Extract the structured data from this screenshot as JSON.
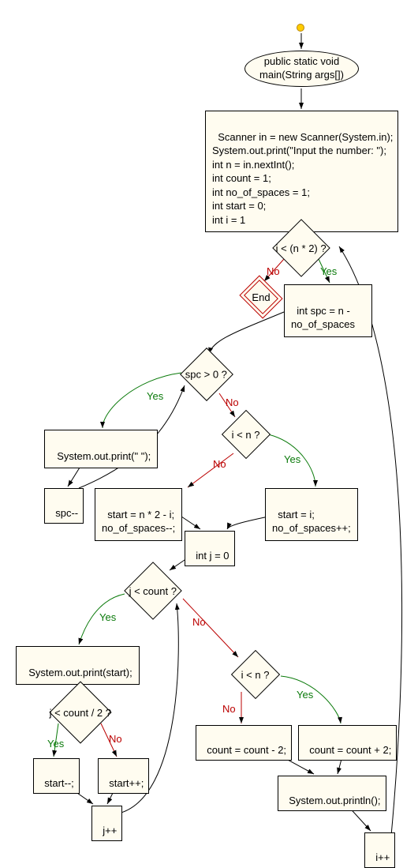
{
  "chart_data": {
    "type": "flowchart",
    "title": "",
    "nodes": [
      {
        "id": "start",
        "type": "start",
        "label": ""
      },
      {
        "id": "main",
        "type": "terminal",
        "label": "public static void\nmain(String args[])"
      },
      {
        "id": "init",
        "type": "process",
        "label": "Scanner in = new Scanner(System.in);\nSystem.out.print(\"Input the number: \");\nint n = in.nextInt();\nint count = 1;\nint no_of_spaces = 1;\nint start = 0;\nint i = 1"
      },
      {
        "id": "d1",
        "type": "decision",
        "label": "i < (n * 2) ?"
      },
      {
        "id": "end",
        "type": "end",
        "label": "End"
      },
      {
        "id": "spc",
        "type": "process",
        "label": "int spc = n -\nno_of_spaces"
      },
      {
        "id": "d2",
        "type": "decision",
        "label": "spc > 0 ?"
      },
      {
        "id": "pspace",
        "type": "process",
        "label": "System.out.print(\" \");"
      },
      {
        "id": "spcdec",
        "type": "process",
        "label": "spc--"
      },
      {
        "id": "d3",
        "type": "decision",
        "label": "i < n ?"
      },
      {
        "id": "startn2i",
        "type": "process",
        "label": "start = n * 2 - i;\nno_of_spaces--;"
      },
      {
        "id": "starti",
        "type": "process",
        "label": "start = i;\nno_of_spaces++;"
      },
      {
        "id": "j0",
        "type": "process",
        "label": "int j = 0"
      },
      {
        "id": "d4",
        "type": "decision",
        "label": "j < count ?"
      },
      {
        "id": "pstart",
        "type": "process",
        "label": "System.out.print(start);"
      },
      {
        "id": "d5",
        "type": "decision",
        "label": "j < count / 2 ?"
      },
      {
        "id": "startdec",
        "type": "process",
        "label": "start--;"
      },
      {
        "id": "startinc",
        "type": "process",
        "label": "start++;"
      },
      {
        "id": "jinc",
        "type": "process",
        "label": "j++"
      },
      {
        "id": "d6",
        "type": "decision",
        "label": "i < n ?"
      },
      {
        "id": "countdec",
        "type": "process",
        "label": "count = count - 2;"
      },
      {
        "id": "countinc",
        "type": "process",
        "label": "count = count + 2;"
      },
      {
        "id": "println",
        "type": "process",
        "label": "System.out.println();"
      },
      {
        "id": "iinc",
        "type": "process",
        "label": "i++"
      }
    ],
    "edges": [
      {
        "from": "start",
        "to": "main",
        "label": ""
      },
      {
        "from": "main",
        "to": "init",
        "label": ""
      },
      {
        "from": "init",
        "to": "d1",
        "label": ""
      },
      {
        "from": "d1",
        "to": "end",
        "label": "No"
      },
      {
        "from": "d1",
        "to": "spc",
        "label": "Yes"
      },
      {
        "from": "spc",
        "to": "d2",
        "label": ""
      },
      {
        "from": "d2",
        "to": "pspace",
        "label": "Yes"
      },
      {
        "from": "pspace",
        "to": "spcdec",
        "label": ""
      },
      {
        "from": "spcdec",
        "to": "d2",
        "label": ""
      },
      {
        "from": "d2",
        "to": "d3",
        "label": "No"
      },
      {
        "from": "d3",
        "to": "starti",
        "label": "Yes"
      },
      {
        "from": "d3",
        "to": "startn2i",
        "label": "No"
      },
      {
        "from": "startn2i",
        "to": "j0",
        "label": ""
      },
      {
        "from": "starti",
        "to": "j0",
        "label": ""
      },
      {
        "from": "j0",
        "to": "d4",
        "label": ""
      },
      {
        "from": "d4",
        "to": "pstart",
        "label": "Yes"
      },
      {
        "from": "pstart",
        "to": "d5",
        "label": ""
      },
      {
        "from": "d5",
        "to": "startdec",
        "label": "Yes"
      },
      {
        "from": "d5",
        "to": "startinc",
        "label": "No"
      },
      {
        "from": "startdec",
        "to": "jinc",
        "label": ""
      },
      {
        "from": "startinc",
        "to": "jinc",
        "label": ""
      },
      {
        "from": "jinc",
        "to": "d4",
        "label": ""
      },
      {
        "from": "d4",
        "to": "d6",
        "label": "No"
      },
      {
        "from": "d6",
        "to": "countinc",
        "label": "Yes"
      },
      {
        "from": "d6",
        "to": "countdec",
        "label": "No"
      },
      {
        "from": "countdec",
        "to": "println",
        "label": ""
      },
      {
        "from": "countinc",
        "to": "println",
        "label": ""
      },
      {
        "from": "println",
        "to": "iinc",
        "label": ""
      },
      {
        "from": "iinc",
        "to": "d1",
        "label": ""
      }
    ]
  },
  "labels": {
    "yes": "Yes",
    "no": "No"
  },
  "nodes": {
    "main": "public static void\nmain(String args[])",
    "init": "Scanner in = new Scanner(System.in);\nSystem.out.print(\"Input the number: \");\nint n = in.nextInt();\nint count = 1;\nint no_of_spaces = 1;\nint start = 0;\nint i = 1",
    "d1": "i < (n * 2) ?",
    "end": "End",
    "spc": "int spc = n -\nno_of_spaces",
    "d2": "spc > 0 ?",
    "pspace": "System.out.print(\" \");",
    "spcdec": "spc--",
    "d3": "i < n ?",
    "startn2i": "start = n * 2 - i;\nno_of_spaces--;",
    "starti": "start = i;\nno_of_spaces++;",
    "j0": "int j = 0",
    "d4": "j < count ?",
    "pstart": "System.out.print(start);",
    "d5": "j < count / 2 ?",
    "startdec": "start--;",
    "startinc": "start++;",
    "jinc": "j++",
    "d6": "i < n ?",
    "countdec": "count = count - 2;",
    "countinc": "count = count + 2;",
    "println": "System.out.println();",
    "iinc": "i++"
  }
}
